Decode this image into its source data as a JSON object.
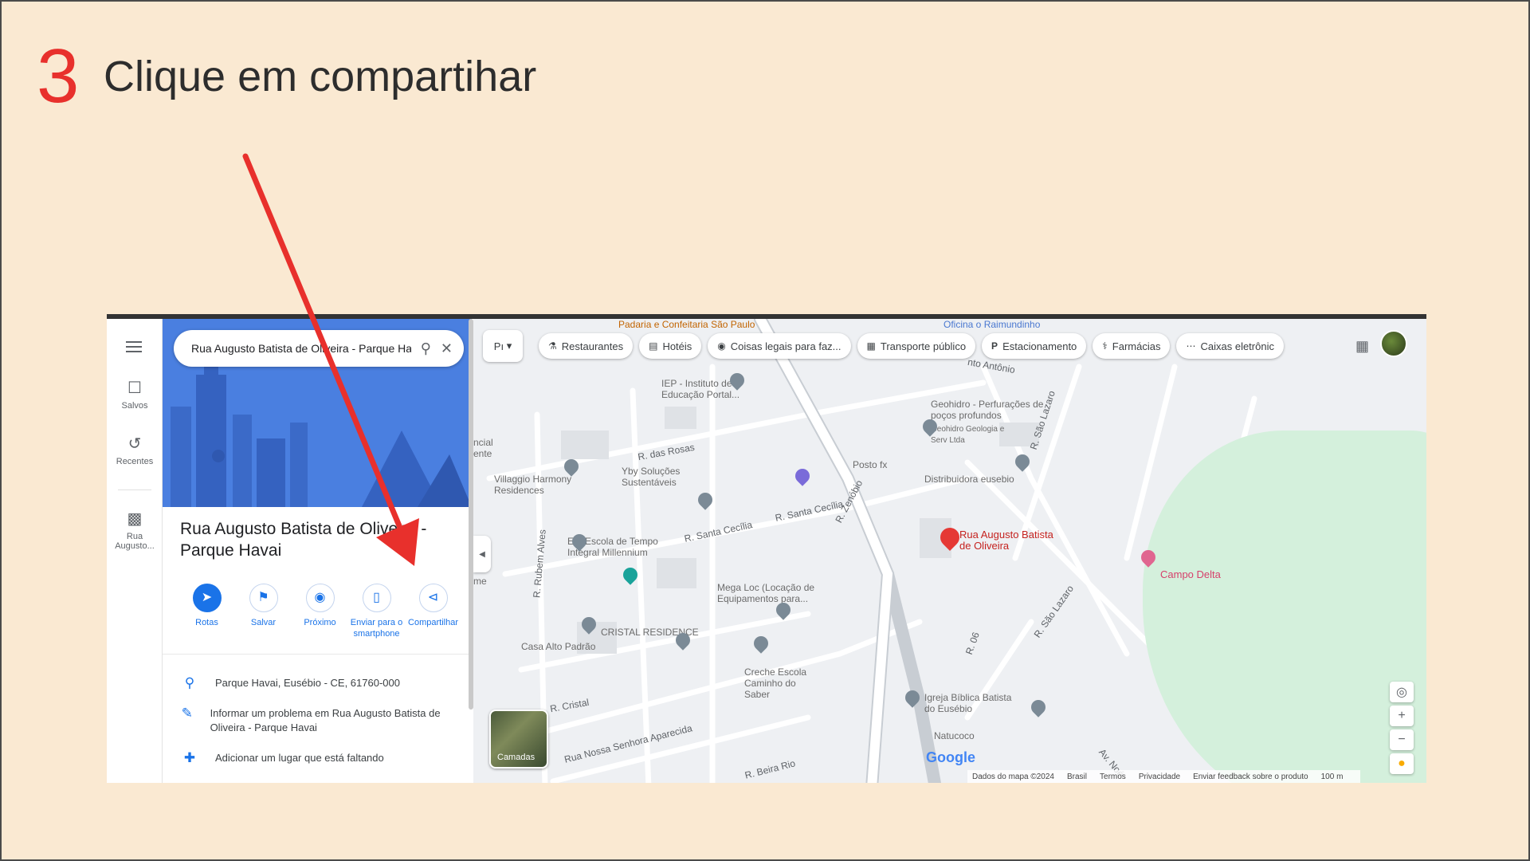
{
  "slide": {
    "step_number": "3",
    "instruction": "Clique em compartihar"
  },
  "rail": {
    "saved": "Salvos",
    "recent": "Recentes",
    "recent_place": "Rua Augusto..."
  },
  "panel": {
    "search_value": "Rua Augusto Batista de Oliveira - Parque Havai",
    "place_title": "Rua Augusto Batista de Oliveira - Parque Havai",
    "actions": {
      "directions": "Rotas",
      "save": "Salvar",
      "nearby": "Próximo",
      "send": "Enviar para o smartphone",
      "share": "Compartilhar"
    },
    "address": "Parque Havai, Eusébio - CE, 61760-000",
    "report": "Informar um problema em Rua Augusto Batista de Oliveira - Parque Havai",
    "add_place": "Adicionar um lugar que está faltando"
  },
  "map": {
    "chips": {
      "layer": "Pı",
      "restaurants": "Restaurantes",
      "hotels": "Hotéis",
      "things": "Coisas legais para faz...",
      "transit": "Transporte público",
      "parking": "Estacionamento",
      "pharmacies": "Farmácias",
      "atms": "Caixas eletrônic"
    },
    "labels": {
      "padaria": "Padaria e Confeitaria São Paulo",
      "oficina": "Oficina o Raimundinho",
      "ieo": "IEP - Instituto de Educação Portal...",
      "geohidro": "Geohidro - Perfurações de poços profundos",
      "geohidro_sub": "Geohidro Geologia e Serv Ltda",
      "posto": "Posto fx",
      "distribuidora": "Distribuidora eusebio",
      "villaggio": "Villaggio Harmony Residences",
      "yby": "Yby Soluções Sustentáveis",
      "eti": "ETI Escola de Tempo Integral Millennium",
      "rua_augusto": "Rua Augusto Batista de Oliveira",
      "campo_delta": "Campo Delta",
      "mega_loc": "Mega Loc (Locação de Equipamentos para...",
      "cristal": "CRISTAL RESIDENCE",
      "casa_alto": "Casa Alto Padrão",
      "creche": "Creche Escola Caminho do Saber",
      "igreja": "Igreja Bíblica Batista do Eusébio",
      "natucoco": "Natucoco",
      "incial": "ncial ente",
      "me": "me"
    },
    "streets": {
      "rosas": "R. das Rosas",
      "santa_cecilia": "R. Santa Cecília",
      "santa_cecilia2": "R. Santa Cecília",
      "zenobio": "R. Zenóbio",
      "sao_lazaro": "R. São Lazaro",
      "sao_lazaro2": "R. São Lazaro",
      "santo_antonio": "nto Antônio",
      "rubem": "R. Rubem Alves",
      "cristal": "R. Cristal",
      "nossa_senhora": "Rua Nossa Senhora Aparecida",
      "beira_rio": "R. Beira Rio",
      "r06": "R. 06",
      "av_noe": "Av. Noé"
    },
    "layers_label": "Camadas",
    "google": "Google",
    "footer": {
      "data": "Dados do mapa ©2024",
      "country": "Brasil",
      "terms": "Termos",
      "privacy": "Privacidade",
      "feedback": "Enviar feedback sobre o produto",
      "scale": "100 m"
    }
  },
  "colors": {
    "background": "#fae9d2",
    "accent_red": "#e8302c",
    "maps_blue": "#1a73e8"
  }
}
